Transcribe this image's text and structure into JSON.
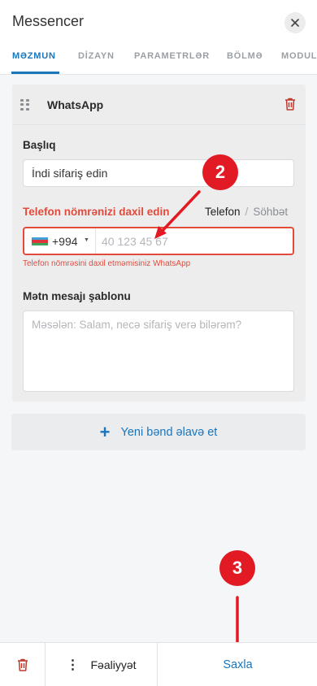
{
  "header": {
    "title": "Messencer",
    "close_icon": "close-icon"
  },
  "tabs": [
    {
      "label": "MƏZMUN",
      "active": true
    },
    {
      "label": "DİZAYN",
      "active": false
    },
    {
      "label": "PARAMETRLƏR",
      "active": false
    },
    {
      "label": "BÖLMƏ",
      "active": false
    },
    {
      "label": "MODUL",
      "active": false
    }
  ],
  "card": {
    "title": "WhatsApp",
    "title_field": {
      "label": "Başlıq",
      "value": "İndi sifariş edin"
    },
    "phone_field": {
      "label": "Telefon nömrənizi daxil edin",
      "country_code": "+994",
      "placeholder": "40 123 45 67",
      "error": "Telefon nömrəsini daxil etməmisiniz WhatsApp",
      "mode_active": "Telefon",
      "mode_separator": "/",
      "mode_inactive": "Söhbət"
    },
    "template_field": {
      "label": "Mətn mesajı şablonu",
      "placeholder": "Məsələn: Salam, necə sifariş verə bilərəm?"
    }
  },
  "add_band": {
    "icon": "+",
    "label": "Yeni bənd əlavə et"
  },
  "annotations": {
    "badge_2": "2",
    "badge_3": "3"
  },
  "footer": {
    "actions_icon": "⋮",
    "actions_label": "Fəaliyyət",
    "save_label": "Saxla"
  },
  "colors": {
    "accent": "#1b75bb",
    "error": "#e24b3b",
    "badge": "#e21a23",
    "trash": "#c0392b"
  }
}
